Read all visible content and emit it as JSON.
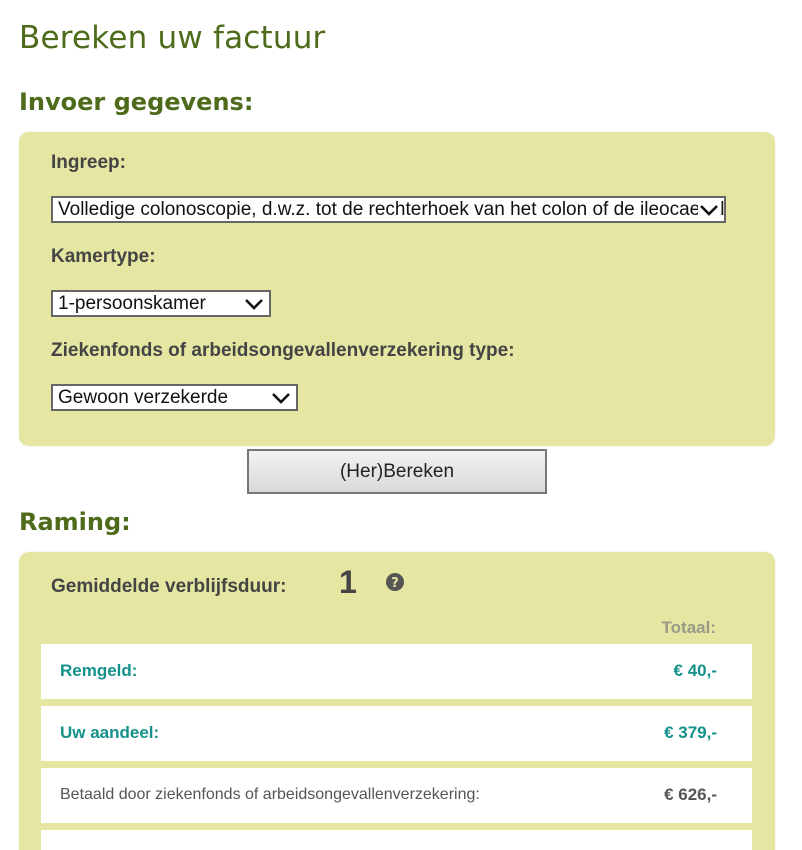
{
  "page": {
    "title": "Bereken uw factuur"
  },
  "input_section": {
    "title": "Invoer gegevens:",
    "ingreep": {
      "label": "Ingreep:",
      "selected": "Volledige colonoscopie, d.w.z. tot de rechterhoek van het colon of de ileocaecale"
    },
    "kamertype": {
      "label": "Kamertype:",
      "selected": "1-persoonskamer"
    },
    "fonds": {
      "label": "Ziekenfonds of arbeidsongevallenverzekering type:",
      "selected": "Gewoon verzekerde"
    }
  },
  "calculate_button": {
    "label": "(Her)Bereken"
  },
  "estimate_section": {
    "title": "Raming:",
    "stay": {
      "label": "Gemiddelde verblijfsduur:",
      "value": "1"
    },
    "total_header": "Totaal:",
    "rows": [
      {
        "label": "Remgeld:",
        "value": "€ 40,-"
      },
      {
        "label": "Uw aandeel:",
        "value": "€ 379,-"
      },
      {
        "label": "Betaald door ziekenfonds of arbeidsongevallenverzekering:",
        "value": "€ 626,-"
      }
    ]
  },
  "colors": {
    "heading_green": "#4d6b1a",
    "panel_bg": "#e6e6a3",
    "accent_teal": "#14928a"
  },
  "icons": {
    "select_caret": "chevron-down-icon",
    "help": "help-icon"
  }
}
